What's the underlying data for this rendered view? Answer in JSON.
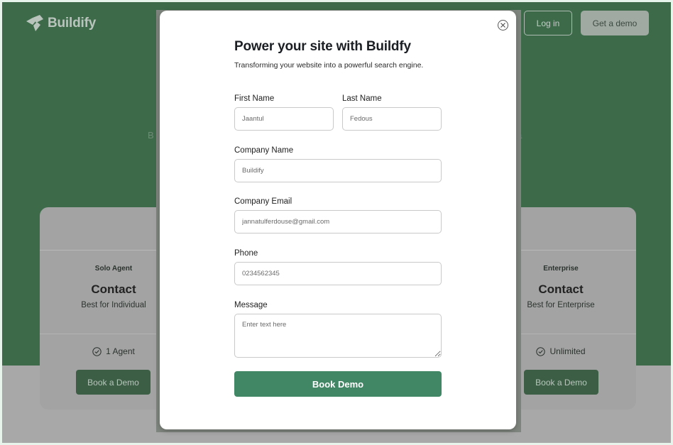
{
  "brand": {
    "name": "Buildify"
  },
  "nav": {
    "login_label": "Log in",
    "demo_label": "Get a demo"
  },
  "hero": {
    "fragment_left": "B",
    "fragment_right": "a"
  },
  "pricing": {
    "plans": [
      {
        "name": "Solo Agent",
        "price": "Contact",
        "subtitle": "Best for Individual",
        "feature": "1 Agent",
        "button": "Book a Demo"
      },
      {
        "name": "Enterprise",
        "price": "Contact",
        "subtitle": "Best for Enterprise",
        "feature": "Unlimited",
        "button": "Book a Demo"
      }
    ]
  },
  "modal": {
    "title": "Power your site with Buildfy",
    "subtitle": "Transforming your website into a powerful search engine.",
    "fields": {
      "first_name": {
        "label": "First Name",
        "placeholder": "Jaantul"
      },
      "last_name": {
        "label": "Last Name",
        "placeholder": "Fedous"
      },
      "company_name": {
        "label": "Company Name",
        "placeholder": "Buildify"
      },
      "company_email": {
        "label": "Company Email",
        "placeholder": "jannatulferdouse@gmail.com"
      },
      "phone": {
        "label": "Phone",
        "placeholder": "0234562345"
      },
      "message": {
        "label": "Message",
        "placeholder": "Enter text here"
      }
    },
    "submit_label": "Book Demo"
  },
  "colors": {
    "hero_green": "#3d6b4a",
    "accent_green": "#428765",
    "overlay_gray": "#a3a3a3"
  }
}
